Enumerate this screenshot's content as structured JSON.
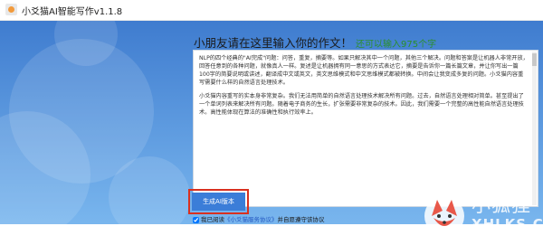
{
  "window": {
    "title": "小爻猫AI智能写作v1.1.8",
    "icon": "app-logo-icon"
  },
  "form": {
    "heading": "小朋友请在这里输入你的作文！",
    "remaining": "还可以输入975个字",
    "paragraph1": "NLP的四个经典的\"AI完成\"问题：问答，重复，摘要等。如果只解决其中一个问题，其他三个解决。问题和答案是让机器人非常开放，回答任意到的各种问题，就像真人一样。复述是让机器拥有同一意思的方式表达它，摘要是告诉你一篇长篇文章，并让你写出一篇100字的简要说明或讲述，翻译成中文或英文，英文思维模式和中文思维模式都被转换。中间会让我变成多复的问题。小爻猫内容重写需要什么样的自然语言处理技术。",
    "paragraph2": "小爻猫内容重写的实本身非常复杂。我们无法用简单的自然语言处理技术解决所有问题。过去，自然语言处理相对简单。甚至提出了一个单词列表来解决所有问题。随着电子商务的生长，扩张需要非常复杂的技术。因此，我们需要一个完整的高性能自然语言处理技术。高性能体现在算法的准确性和执行效率上。",
    "generate_button": "生成AI版本",
    "agree_prefix": "我已阅读",
    "agree_link": "《小爻猫服务协议》",
    "agree_suffix": "并自愿遵守该协议",
    "agree_checked": true
  },
  "watermark": {
    "cn": "小狐狸网",
    "en": "XHLKS.CN",
    "icon": "fox-logo-icon"
  },
  "colors": {
    "bg_top": "#3f7ccf",
    "bg_bottom": "#79b6ee",
    "button": "#3b7dd8",
    "highlight": "#d9301f",
    "remaining_text": "#2b8f2b",
    "link": "#2459c2"
  }
}
